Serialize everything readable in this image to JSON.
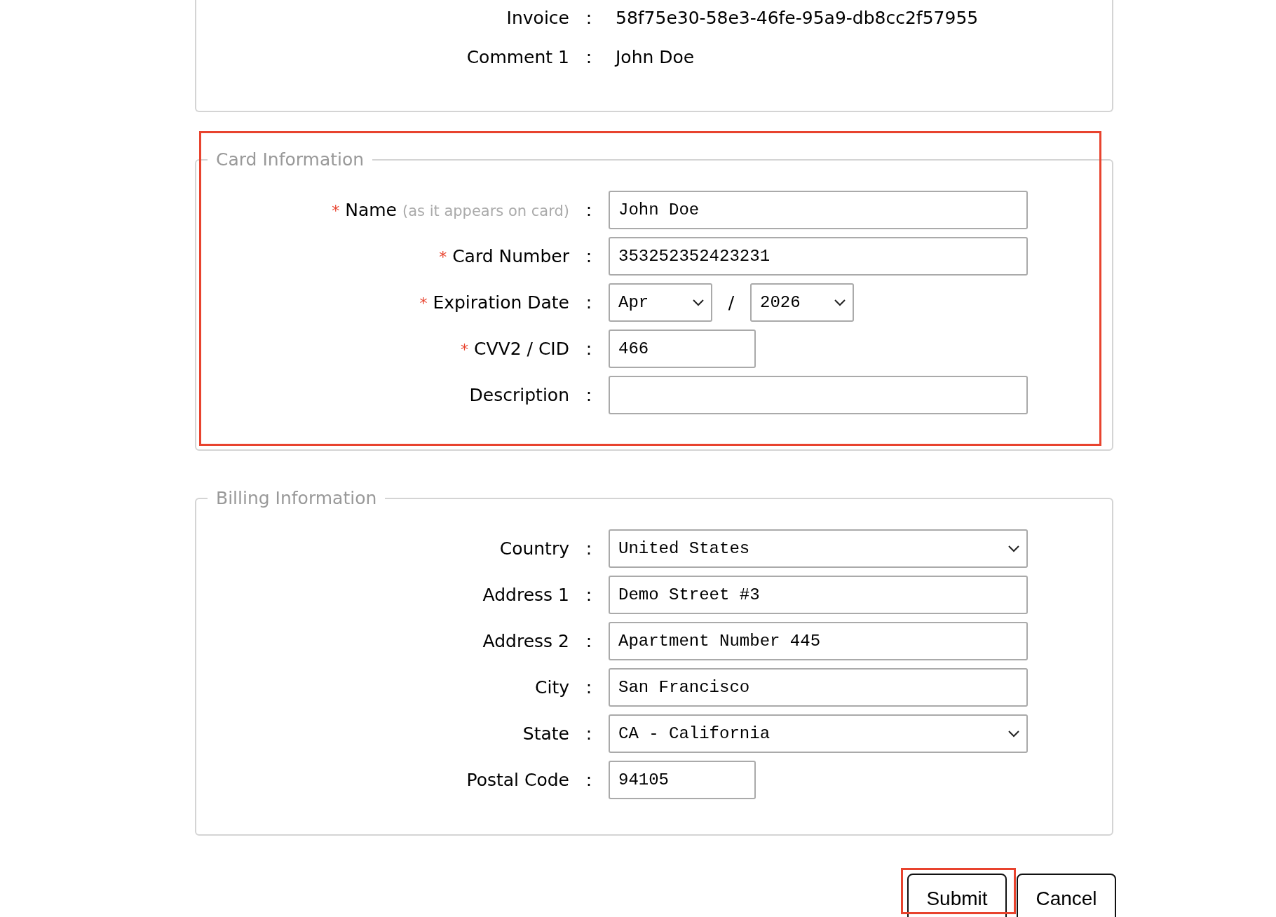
{
  "summary": {
    "rows": [
      {
        "label": "Invoice",
        "colon": ":",
        "value": "58f75e30-58e3-46fe-95a9-db8cc2f57955"
      },
      {
        "label": "Comment 1",
        "colon": ":",
        "value": "John Doe"
      }
    ]
  },
  "card_section": {
    "legend": "Card Information",
    "highlighted": true,
    "fields": [
      {
        "kind": "text",
        "marker": "*",
        "label": "Name",
        "hint": "(as it appears on card)",
        "colon": ":",
        "value": "John Doe"
      },
      {
        "kind": "text",
        "marker": "*",
        "label": "Card Number",
        "colon": ":",
        "value": "353252352423231"
      },
      {
        "kind": "date",
        "marker": "*",
        "label": "Expiration Date",
        "colon": ":",
        "month": "Apr",
        "separator": "/",
        "year": "2026"
      },
      {
        "kind": "short_text",
        "marker": "*",
        "label": "CVV2 / CID",
        "colon": ":",
        "value": "466"
      },
      {
        "kind": "text",
        "label": "Description",
        "colon": ":"
      }
    ]
  },
  "billing_section": {
    "legend": "Billing Information",
    "fields": [
      {
        "kind": "select",
        "label": "Country",
        "colon": ":",
        "value": "United States"
      },
      {
        "kind": "text",
        "label": "Address 1",
        "colon": ":",
        "value": "Demo Street #3"
      },
      {
        "kind": "text",
        "label": "Address 2",
        "colon": ":",
        "value": "Apartment Number 445"
      },
      {
        "kind": "text",
        "label": "City",
        "colon": ":",
        "value": "San Francisco"
      },
      {
        "kind": "select",
        "label": "State",
        "colon": ":",
        "value": "CA - California"
      },
      {
        "kind": "short_text",
        "label": "Postal Code",
        "colon": ":",
        "value": "94105"
      }
    ]
  },
  "buttons": [
    {
      "label": "Submit",
      "highlighted": true
    },
    {
      "label": "Cancel",
      "highlighted": false
    }
  ]
}
